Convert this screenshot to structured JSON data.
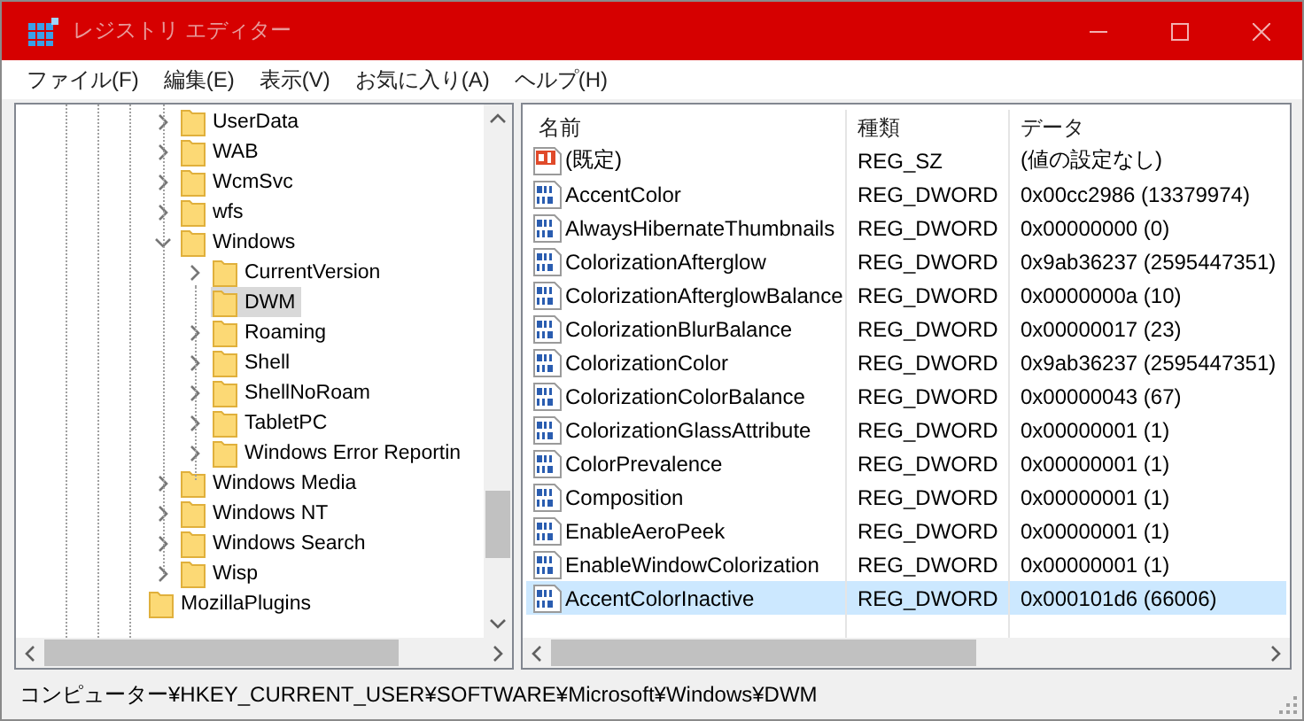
{
  "window": {
    "title": "レジストリ エディター"
  },
  "menu": [
    {
      "label": "ファイル(F)"
    },
    {
      "label": "編集(E)"
    },
    {
      "label": "表示(V)"
    },
    {
      "label": "お気に入り(A)"
    },
    {
      "label": "ヘルプ(H)"
    }
  ],
  "tree": {
    "nodes": [
      {
        "label": "UserData",
        "expanded": false,
        "selected": false
      },
      {
        "label": "WAB",
        "expanded": false,
        "selected": false
      },
      {
        "label": "WcmSvc",
        "expanded": false,
        "selected": false
      },
      {
        "label": "wfs",
        "expanded": false,
        "selected": false
      },
      {
        "label": "Windows",
        "expanded": true,
        "selected": false,
        "children": [
          {
            "label": "CurrentVersion",
            "expanded": false,
            "selected": false
          },
          {
            "label": "DWM",
            "selected": true
          },
          {
            "label": "Roaming",
            "expanded": false,
            "selected": false
          },
          {
            "label": "Shell",
            "expanded": false,
            "selected": false
          },
          {
            "label": "ShellNoRoam",
            "expanded": false,
            "selected": false
          },
          {
            "label": "TabletPC",
            "expanded": false,
            "selected": false
          },
          {
            "label": "Windows Error Reportin",
            "expanded": false,
            "selected": false
          }
        ]
      },
      {
        "label": "Windows Media",
        "expanded": false,
        "selected": false
      },
      {
        "label": "Windows NT",
        "expanded": false,
        "selected": false
      },
      {
        "label": "Windows Search",
        "expanded": false,
        "selected": false
      },
      {
        "label": "Wisp",
        "expanded": false,
        "selected": false
      }
    ],
    "outer_nodes": [
      {
        "label": "MozillaPlugins",
        "selected": false
      }
    ]
  },
  "table": {
    "columns": [
      "名前",
      "種類",
      "データ"
    ],
    "rows": [
      {
        "kind": "string",
        "name": "(既定)",
        "type": "REG_SZ",
        "data": "(値の設定なし)",
        "selected": false
      },
      {
        "kind": "binary",
        "name": "AccentColor",
        "type": "REG_DWORD",
        "data": "0x00cc2986 (13379974)",
        "selected": false
      },
      {
        "kind": "binary",
        "name": "AlwaysHibernateThumbnails",
        "type": "REG_DWORD",
        "data": "0x00000000 (0)",
        "selected": false
      },
      {
        "kind": "binary",
        "name": "ColorizationAfterglow",
        "type": "REG_DWORD",
        "data": "0x9ab36237 (2595447351)",
        "selected": false
      },
      {
        "kind": "binary",
        "name": "ColorizationAfterglowBalance",
        "type": "REG_DWORD",
        "data": "0x0000000a (10)",
        "selected": false
      },
      {
        "kind": "binary",
        "name": "ColorizationBlurBalance",
        "type": "REG_DWORD",
        "data": "0x00000017 (23)",
        "selected": false
      },
      {
        "kind": "binary",
        "name": "ColorizationColor",
        "type": "REG_DWORD",
        "data": "0x9ab36237 (2595447351)",
        "selected": false
      },
      {
        "kind": "binary",
        "name": "ColorizationColorBalance",
        "type": "REG_DWORD",
        "data": "0x00000043 (67)",
        "selected": false
      },
      {
        "kind": "binary",
        "name": "ColorizationGlassAttribute",
        "type": "REG_DWORD",
        "data": "0x00000001 (1)",
        "selected": false
      },
      {
        "kind": "binary",
        "name": "ColorPrevalence",
        "type": "REG_DWORD",
        "data": "0x00000001 (1)",
        "selected": false
      },
      {
        "kind": "binary",
        "name": "Composition",
        "type": "REG_DWORD",
        "data": "0x00000001 (1)",
        "selected": false
      },
      {
        "kind": "binary",
        "name": "EnableAeroPeek",
        "type": "REG_DWORD",
        "data": "0x00000001 (1)",
        "selected": false
      },
      {
        "kind": "binary",
        "name": "EnableWindowColorization",
        "type": "REG_DWORD",
        "data": "0x00000001 (1)",
        "selected": false
      },
      {
        "kind": "binary",
        "name": "AccentColorInactive",
        "type": "REG_DWORD",
        "data": "0x000101d6 (66006)",
        "selected": true
      }
    ]
  },
  "status_bar": {
    "path": "コンピューター¥HKEY_CURRENT_USER¥SOFTWARE¥Microsoft¥Windows¥DWM"
  }
}
